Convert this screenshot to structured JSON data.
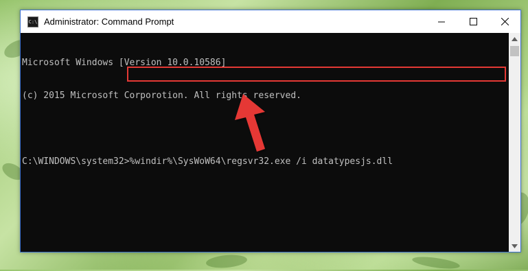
{
  "window": {
    "title": "Administrator: Command Prompt",
    "icon_label": "C:\\"
  },
  "console": {
    "lines": [
      "Microsoft Windows [Version 10.0.10586]",
      "(c) 2015 Microsoft Corporotion. All rights reserved.",
      "",
      "C:\\WINDOWS\\system32>%windir%\\SysWoW64\\regsvr32.exe /i datatypesjs.dll"
    ]
  },
  "colors": {
    "highlight": "#e53935",
    "arrow": "#e53935",
    "console_bg": "#0c0c0c",
    "console_text": "#c0c0c0"
  },
  "icons": [
    "minimize-icon",
    "maximize-icon",
    "close-icon",
    "scroll-up-icon",
    "scroll-down-icon"
  ]
}
